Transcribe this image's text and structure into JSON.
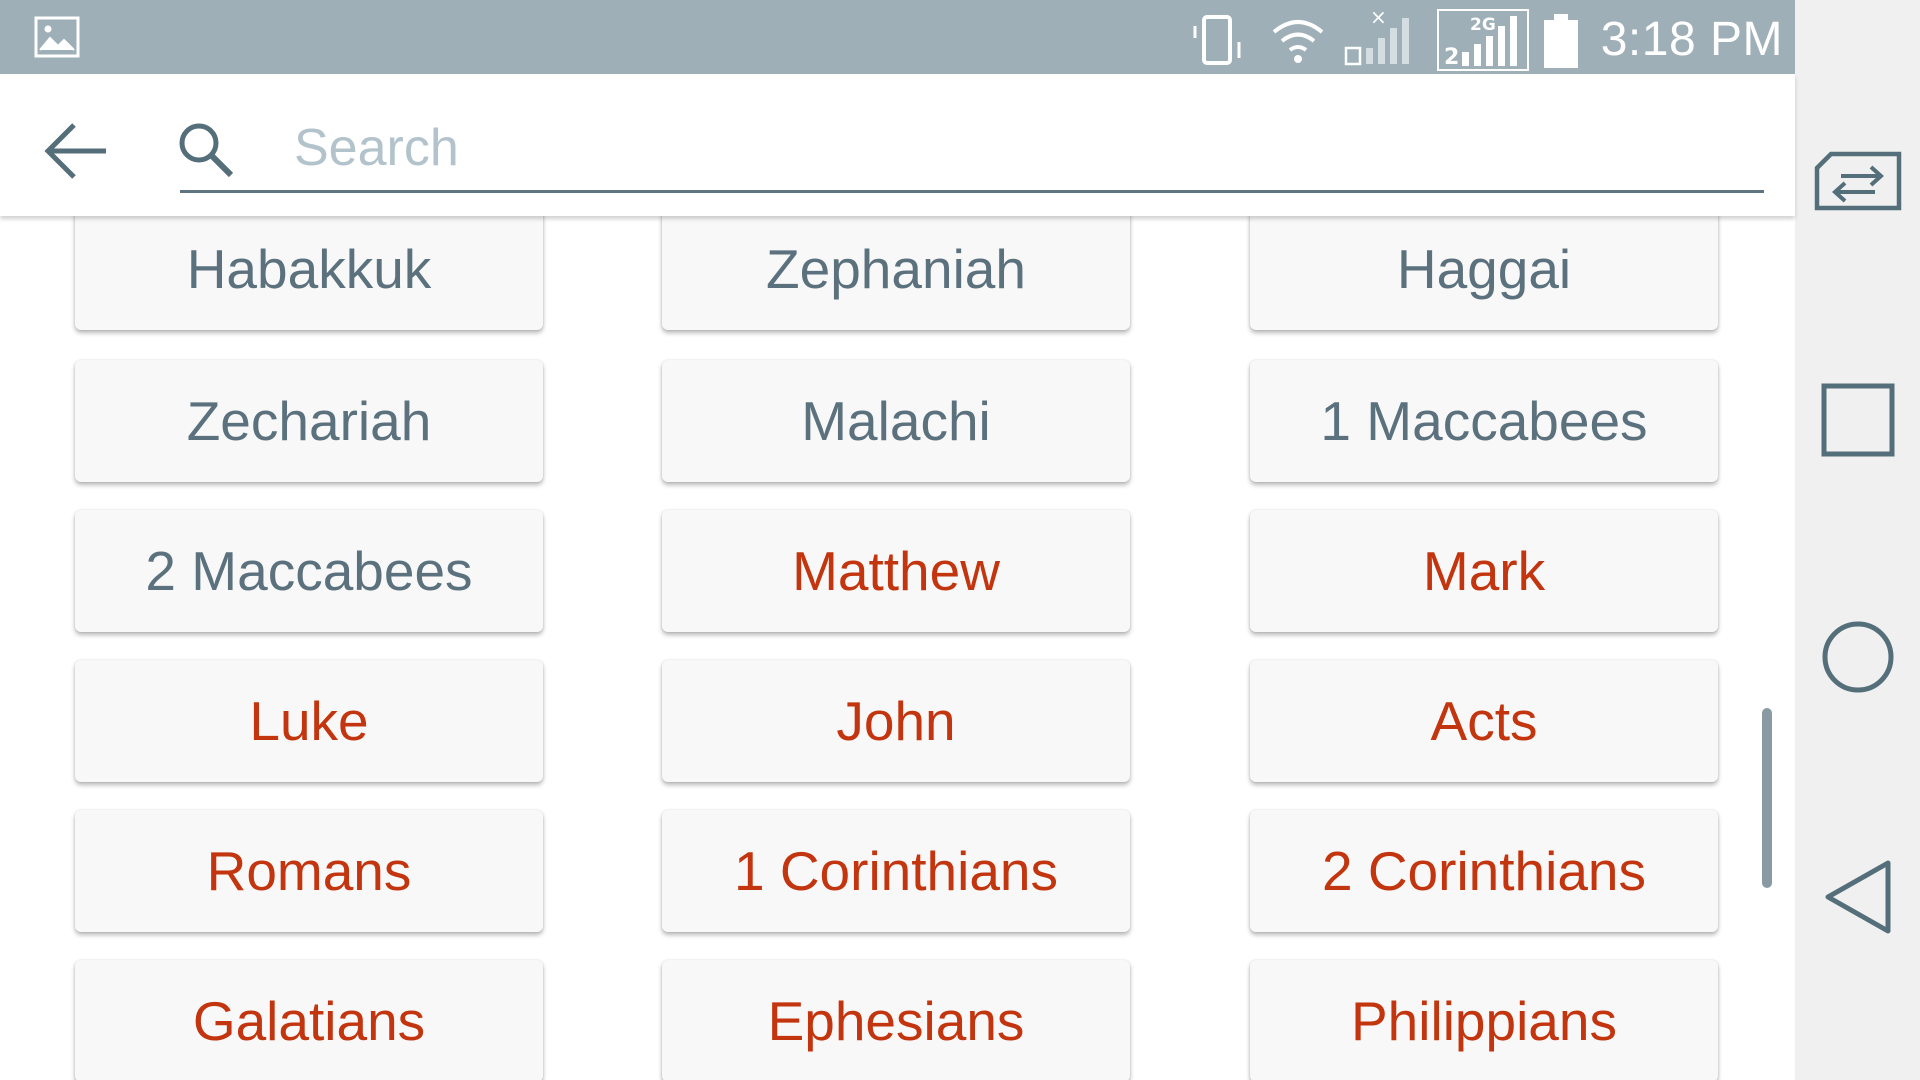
{
  "status_bar": {
    "time": "3:18 PM",
    "network_label": "2G",
    "sim_slot": "2",
    "icons": [
      "gallery-icon",
      "vibrate-icon",
      "wifi-icon",
      "signal-sim1-icon",
      "signal-sim2-icon",
      "battery-icon"
    ]
  },
  "search": {
    "placeholder": "Search",
    "value": ""
  },
  "books": [
    {
      "name": "Habakkuk",
      "testament": "ot"
    },
    {
      "name": "Zephaniah",
      "testament": "ot"
    },
    {
      "name": "Haggai",
      "testament": "ot"
    },
    {
      "name": "Zechariah",
      "testament": "ot"
    },
    {
      "name": "Malachi",
      "testament": "ot"
    },
    {
      "name": "1 Maccabees",
      "testament": "ot"
    },
    {
      "name": "2 Maccabees",
      "testament": "ot"
    },
    {
      "name": "Matthew",
      "testament": "nt"
    },
    {
      "name": "Mark",
      "testament": "nt"
    },
    {
      "name": "Luke",
      "testament": "nt"
    },
    {
      "name": "John",
      "testament": "nt"
    },
    {
      "name": "Acts",
      "testament": "nt"
    },
    {
      "name": "Romans",
      "testament": "nt"
    },
    {
      "name": "1 Corinthians",
      "testament": "nt"
    },
    {
      "name": "2 Corinthians",
      "testament": "nt"
    },
    {
      "name": "Galatians",
      "testament": "nt"
    },
    {
      "name": "Ephesians",
      "testament": "nt"
    },
    {
      "name": "Philippians",
      "testament": "nt"
    }
  ],
  "colors": {
    "old_testament_text": "#5b717d",
    "new_testament_text": "#c2350e",
    "status_bar_bg": "#9eafb8",
    "accent": "#5e7480"
  },
  "nav_bar": {
    "icons": [
      "switch-sim-icon",
      "recents-icon",
      "home-icon",
      "back-nav-icon"
    ]
  }
}
